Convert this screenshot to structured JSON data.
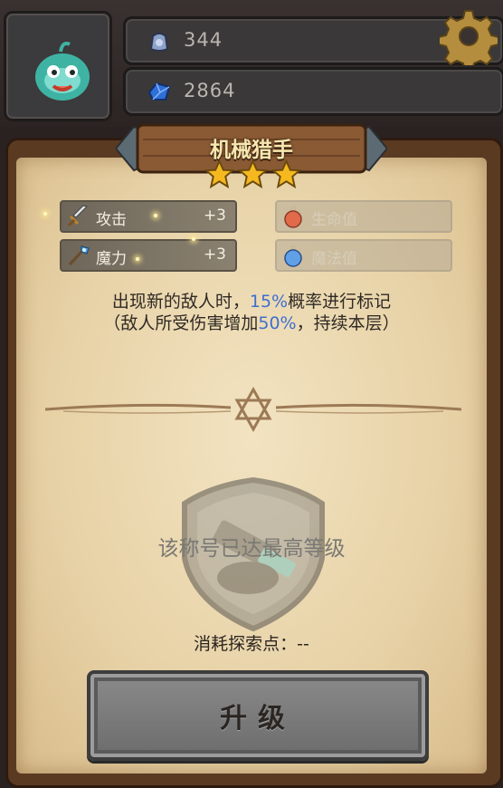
{
  "hud": {
    "currency1": {
      "icon": "gem-pouch-icon",
      "value": "344"
    },
    "currency2": {
      "icon": "blue-crystal-icon",
      "value": "2864"
    }
  },
  "title": {
    "name": "机械猎手",
    "stars": 3,
    "max_stars": 3
  },
  "stats": [
    {
      "icon": "sword-icon",
      "label": "攻击",
      "value": "+3",
      "active": true
    },
    {
      "icon": "red-potion-icon",
      "label": "生命值",
      "value": "",
      "active": false
    },
    {
      "icon": "magic-staff-icon",
      "label": "魔力",
      "value": "+3",
      "active": true
    },
    {
      "icon": "blue-potion-icon",
      "label": "魔法值",
      "value": "",
      "active": false
    }
  ],
  "description": {
    "line1_a": "出现新的敌人时，",
    "line1_hl": "15%",
    "line1_b": "概率进行标记",
    "line2_a": "（敌人所受伤害增加",
    "line2_hl": "50%",
    "line2_b": "，持续本层）"
  },
  "status": {
    "maxed_text": "该称号已达最高等级",
    "cost_text": "消耗探索点：--"
  },
  "button": {
    "upgrade_label": "升级"
  },
  "colors": {
    "highlight": "#3e6fd1",
    "title": "#f7e7b0",
    "parchment": "#ecd8b0"
  }
}
